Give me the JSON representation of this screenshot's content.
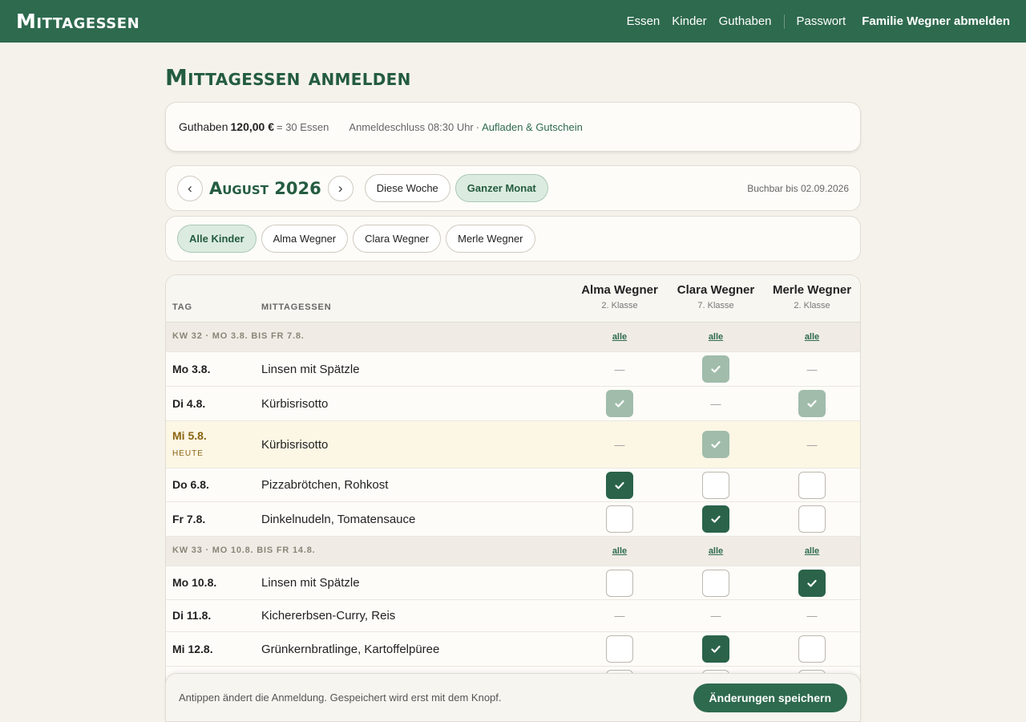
{
  "app": {
    "brand": "Mittagessen"
  },
  "nav": {
    "items": [
      "Essen",
      "Kinder",
      "Guthaben"
    ],
    "password": "Passwort",
    "logout": "Familie Wegner abmelden"
  },
  "page": {
    "title": "Mittagessen anmelden"
  },
  "balance": {
    "label": "Guthaben",
    "amount": "120,00 €",
    "equiv": "= 30 Essen",
    "deadline": "Anmeldeschluss 08:30 Uhr",
    "dot": "·",
    "topup_link": "Aufladen & Gutschein"
  },
  "month": {
    "prev": "‹",
    "next": "›",
    "label": "August 2026",
    "week_btn": "Diese Woche",
    "month_btn": "Ganzer Monat",
    "bookable": "Buchbar bis 02.09.2026"
  },
  "kid_filter": [
    "Alle Kinder",
    "Alma Wegner",
    "Clara Wegner",
    "Merle Wegner"
  ],
  "table": {
    "col_day": "TAG",
    "col_meal": "MITTAGESSEN",
    "kids": [
      {
        "name": "Alma Wegner",
        "class": "2. Klasse"
      },
      {
        "name": "Clara Wegner",
        "class": "7. Klasse"
      },
      {
        "name": "Merle Wegner",
        "class": "2. Klasse"
      }
    ],
    "all_label": "alle",
    "today_tag": "HEUTE",
    "weeks": [
      {
        "label": "KW 32 · MO 3.8. BIS FR 7.8.",
        "days": [
          {
            "day": "Mo 3.8.",
            "meal": "Linsen mit Spätzle",
            "status": [
              "none",
              "locked",
              "none"
            ]
          },
          {
            "day": "Di 4.8.",
            "meal": "Kürbisrisotto",
            "status": [
              "locked",
              "none",
              "locked"
            ]
          },
          {
            "day": "Mi 5.8.",
            "meal": "Kürbisrisotto",
            "status": [
              "none",
              "locked",
              "none"
            ],
            "today": true
          },
          {
            "day": "Do 6.8.",
            "meal": "Pizzabrötchen, Rohkost",
            "status": [
              "on",
              "off",
              "off"
            ]
          },
          {
            "day": "Fr 7.8.",
            "meal": "Dinkelnudeln, Tomatensauce",
            "status": [
              "off",
              "on",
              "off"
            ]
          }
        ]
      },
      {
        "label": "KW 33 · MO 10.8. BIS FR 14.8.",
        "days": [
          {
            "day": "Mo 10.8.",
            "meal": "Linsen mit Spätzle",
            "status": [
              "off",
              "off",
              "on"
            ]
          },
          {
            "day": "Di 11.8.",
            "meal": "Kichererbsen-Curry, Reis",
            "status": [
              "none",
              "none",
              "none"
            ]
          },
          {
            "day": "Mi 12.8.",
            "meal": "Grünkernbratlinge, Kartoffelpüree",
            "status": [
              "off",
              "on",
              "off"
            ]
          },
          {
            "day": "",
            "meal": "",
            "status": [
              "off",
              "off",
              "off"
            ]
          }
        ]
      }
    ]
  },
  "footer": {
    "hint": "Antippen ändert die Anmeldung. Gespeichert wird erst mit dem Knopf.",
    "save": "Änderungen speichern"
  },
  "colors": {
    "brand": "#2e6a4e",
    "checked": "#2a6349",
    "locked": "#a1bcab",
    "today_bg": "#fcf6e5"
  }
}
